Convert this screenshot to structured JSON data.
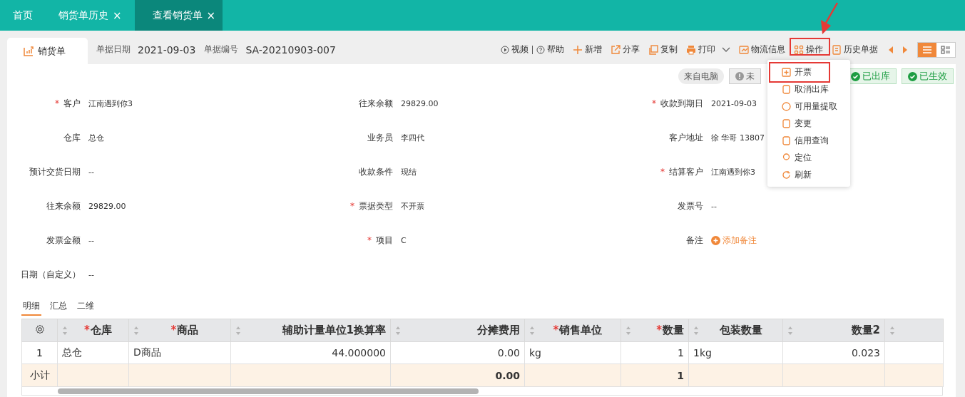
{
  "tabs": [
    {
      "label": "首页",
      "closable": false,
      "selected": false
    },
    {
      "label": "销货单历史",
      "closable": true,
      "selected": false
    },
    {
      "label": "查看销货单",
      "closable": true,
      "selected": true
    }
  ],
  "close_glyph": "×",
  "required_glyph": "*",
  "doc_tab": {
    "label": "销货单"
  },
  "header_fields": [
    {
      "label": "单据日期",
      "value": "2021-09-03"
    },
    {
      "label": "单据编号",
      "value": "SA-20210903-007"
    }
  ],
  "help_links": [
    "视频",
    "帮助"
  ],
  "actions": [
    {
      "label": "新增",
      "dropdown": false
    },
    {
      "label": "分享",
      "dropdown": false
    },
    {
      "label": "复制",
      "dropdown": false
    },
    {
      "label": "打印",
      "dropdown": true
    },
    {
      "label": "物流信息",
      "dropdown": false
    },
    {
      "label": "操作",
      "dropdown": false
    },
    {
      "label": "历史单据",
      "dropdown": false
    }
  ],
  "view_toggle": [
    {
      "kind": "list",
      "selected": true
    },
    {
      "kind": "card",
      "selected": false
    }
  ],
  "badges": [
    {
      "label": "来自电脑",
      "kind": "source"
    },
    {
      "label": "未",
      "kind": "warning"
    },
    {
      "label": "已出库",
      "kind": "done"
    },
    {
      "label": "已生效",
      "kind": "done"
    }
  ],
  "form": {
    "columns": [
      [
        {
          "label": "客户",
          "value": "江南遇到你3",
          "required": true
        },
        {
          "label": "仓库",
          "value": "总仓",
          "required": false
        },
        {
          "label": "预计交货日期",
          "value": "--",
          "required": false
        },
        {
          "label": "往来余额",
          "value": "29829.00",
          "required": false
        },
        {
          "label": "发票金额",
          "value": "--",
          "required": false
        },
        {
          "label": "日期（自定义）",
          "value": "--",
          "required": false
        }
      ],
      [
        {
          "label": "往来余额",
          "value": "29829.00",
          "required": false
        },
        {
          "label": "业务员",
          "value": "李四代",
          "required": false
        },
        {
          "label": "收款条件",
          "value": "现结",
          "required": false
        },
        {
          "label": "票据类型",
          "value": "不开票",
          "required": true
        },
        {
          "label": "项目",
          "value": "C",
          "required": true
        }
      ],
      [
        {
          "label": "收款到期日",
          "value": "2021-09-03",
          "required": true
        },
        {
          "label": "客户地址",
          "value": "徐 华哥 13807",
          "required": false
        },
        {
          "label": "结算客户",
          "value": "江南遇到你3",
          "required": true
        },
        {
          "label": "发票号",
          "value": "--",
          "required": false
        },
        {
          "label": "备注",
          "value": "添加备注",
          "required": false,
          "kind": "link"
        }
      ]
    ]
  },
  "detail_tabs": [
    {
      "label": "明细",
      "selected": true
    },
    {
      "label": "汇总",
      "selected": false
    },
    {
      "label": "二维",
      "selected": false
    }
  ],
  "table": {
    "columns": [
      {
        "label": "仓库",
        "required": true
      },
      {
        "label": "商品",
        "required": true
      },
      {
        "label": "辅助计量单位1换算率",
        "required": false
      },
      {
        "label": "分摊费用",
        "required": false
      },
      {
        "label": "销售单位",
        "required": true
      },
      {
        "label": "数量",
        "required": true
      },
      {
        "label": "包装数量",
        "required": false
      },
      {
        "label": "数量2",
        "required": false
      }
    ],
    "rows": [
      {
        "index": "1",
        "cells": [
          "总仓",
          "D商品",
          "44.000000",
          "0.00",
          "kg",
          "1",
          "1kg",
          "0.023"
        ]
      }
    ],
    "subtotal": {
      "label": "小计",
      "cells": [
        "",
        "",
        "",
        "0.00",
        "",
        "1",
        "",
        ""
      ]
    }
  },
  "menu": {
    "items": [
      "开票",
      "取消出库",
      "可用量提取",
      "变更",
      "信用查询",
      "定位",
      "刷新"
    ]
  }
}
